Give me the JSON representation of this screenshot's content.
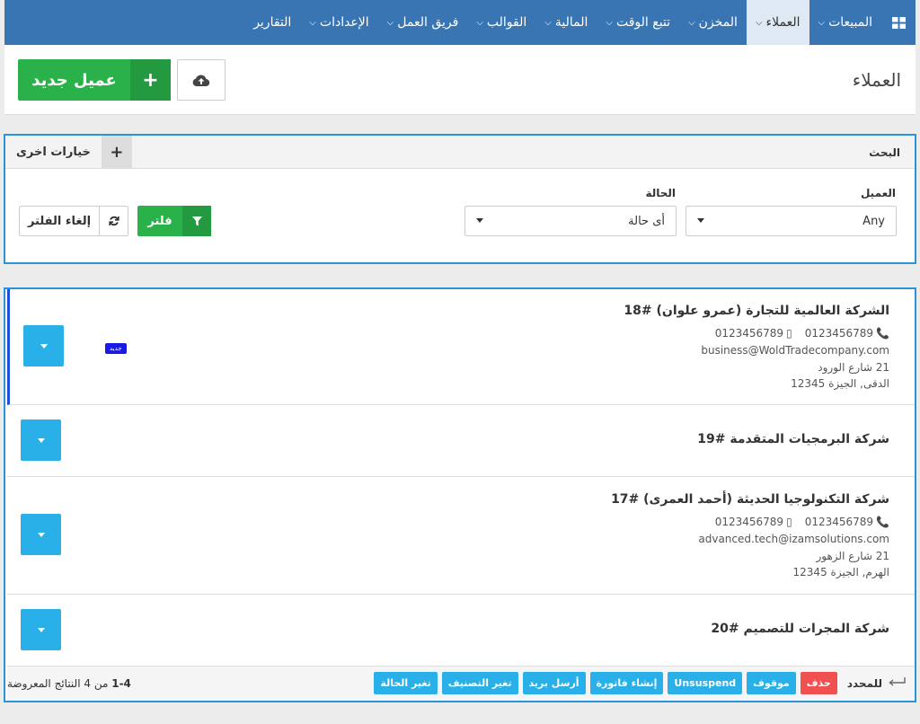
{
  "nav": {
    "items": [
      {
        "label": "المبيعات",
        "chevron": true,
        "active": false
      },
      {
        "label": "العملاء",
        "chevron": true,
        "active": true
      },
      {
        "label": "المخزن",
        "chevron": true,
        "active": false
      },
      {
        "label": "تتبع الوقت",
        "chevron": true,
        "active": false
      },
      {
        "label": "المالية",
        "chevron": true,
        "active": false
      },
      {
        "label": "القوالب",
        "chevron": true,
        "active": false
      },
      {
        "label": "فريق العمل",
        "chevron": true,
        "active": false
      },
      {
        "label": "الإعدادات",
        "chevron": true,
        "active": false
      },
      {
        "label": "التقارير",
        "chevron": false,
        "active": false
      }
    ]
  },
  "header": {
    "title": "العملاء",
    "new_client_label": "عميل جديد"
  },
  "search": {
    "title": "البحث",
    "more_options": "خيارات اخرى",
    "client_label": "العميل",
    "client_value": "Any",
    "status_label": "الحالة",
    "status_value": "أى حالة",
    "filter_label": "فلتر",
    "reset_label": "إلغاء الفلتر"
  },
  "clients": [
    {
      "name": "الشركة العالمية للتجارة (عمرو علوان) #18",
      "phone": "0123456789",
      "mobile": "0123456789",
      "email": "business@WoldTradecompany.com",
      "address1": "21 شارع الورود",
      "address2": "الدقى, الجيزة 12345",
      "badge": "جديد"
    },
    {
      "name": "شركة البرمجيات المتقدمة #19"
    },
    {
      "name": "شركة التكنولوجيا الحديثة (أحمد العمرى) #17",
      "phone": "0123456789",
      "mobile": "0123456789",
      "email": "advanced.tech@izamsolutions.com",
      "address1": "21 شارع الزهور",
      "address2": "الهرم, الجيزة 12345"
    },
    {
      "name": "شركة المجرات للتصميم #20"
    }
  ],
  "footer": {
    "selected_label": "للمحدد",
    "actions": {
      "delete": "حذف",
      "suspend": "موقوف",
      "unsuspend": "Unsuspend",
      "create_invoice": "إنشاء فاتورة",
      "send_email": "أرسل بريد",
      "change_category": "تغير التصنيف",
      "change_status": "تغير الحالة"
    },
    "pager_range": "1-4",
    "pager_text": "من 4 النتائج المعروضة"
  },
  "colors": {
    "nav": "#3a75b3",
    "green": "#2ab14a",
    "blue": "#29b0e8",
    "red": "#f05050",
    "panel_border": "#2b94d8"
  }
}
